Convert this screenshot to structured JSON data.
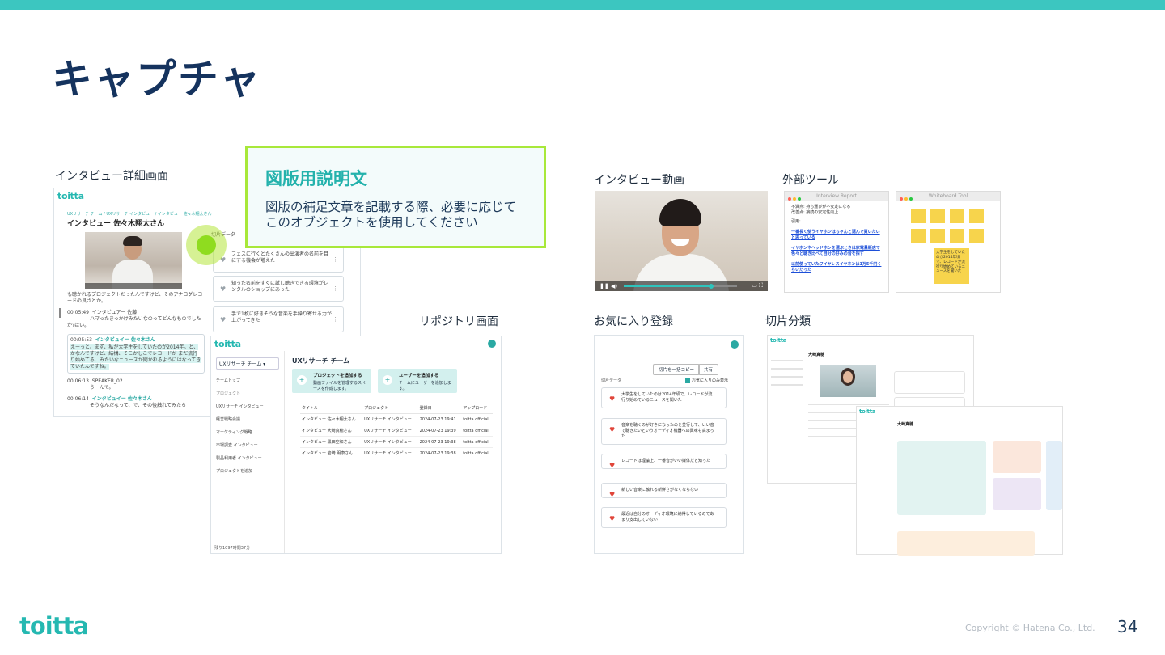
{
  "slide": {
    "title": "キャプチャ",
    "page_number": "34",
    "copyright": "Copyright © Hatena Co., Ltd.",
    "logo": "toitta",
    "accent_color": "#3cc6c0"
  },
  "callout": {
    "title": "図版用説明文",
    "body_line1": "図版の補足文章を記載する際、必要に応じて",
    "body_line2": "このオブジェクトを使用してください"
  },
  "captions": {
    "detail": "インタビュー詳細画面",
    "repository": "リポジトリ画面",
    "video": "インタビュー動画",
    "external": "外部ツール",
    "favorites": "お気に入り登録",
    "classification": "切片分類"
  },
  "detail_screen": {
    "logo": "toitta",
    "breadcrumb": "UXリサーチ チーム / UXリサーチ インタビュー / インタビュー 佐々木翔太さん",
    "title": "インタビュー 佐々木翔太さん",
    "clip_label": "切片データ",
    "transcript": [
      {
        "time": "",
        "speaker": "",
        "text": "も聴かれるプロジェクトだったんですけど、そのアナログレコードの良さとか。"
      },
      {
        "time": "00:05:49",
        "speaker": "インタビュアー 佐藤",
        "text": "ハマったきっかけみたいなのってどんなものでしたか?はい。"
      },
      {
        "time": "00:05:53",
        "speaker": "インタビュイー 佐々木さん",
        "text": "えーっと、まず、私が大学生をしていたのが2014年。と、かなんですけど、結構、そこかしこでレコードが まだ流行り始めてる、みたいなニュースが聞かれるようにはなってきていたんですね。"
      },
      {
        "time": "00:06:13",
        "speaker": "SPEAKER_02",
        "text": "うーんで。"
      },
      {
        "time": "00:06:14",
        "speaker": "インタビュイー 佐々木さん",
        "text": "そうなんだなって、で、その後触れてみたら"
      }
    ],
    "clips": [
      "フェスに行くとたくさんの出演者の名前を目にする機会が増えた",
      "知った名前をすぐに試し聴きできる環境がレンタルのショップにあった",
      "手で1枚に好きそうな音楽を手繰り寄せる力が上がってきた"
    ]
  },
  "repo_screen": {
    "logo": "toitta",
    "team": "UXリサーチ チーム",
    "title": "UXリサーチ チーム",
    "nav_top": "チームトップ",
    "nav_section": "プロジェクト",
    "projects": [
      "UXリサーチ インタビュー",
      "経営戦略会議",
      "マーケティング戦略",
      "市場調査 インタビュー",
      "製品利用者 インタビュー"
    ],
    "add_project_nav": "プロジェクトを追加",
    "action1_title": "プロジェクトを追加する",
    "action1_desc": "動画ファイルを管理するスペースを作成します。",
    "action2_title": "ユーザーを追加する",
    "action2_desc": "チームにユーザーを追加します。",
    "columns": [
      "タイトル",
      "プロジェクト",
      "登録日",
      "アップロード"
    ],
    "rows": [
      [
        "インタビュー 佐々木翔太さん",
        "UXリサーチ インタビュー",
        "2024-07-23 19:41",
        "toitta official"
      ],
      [
        "インタビュー 大崎真穂さん",
        "UXリサーチ インタビュー",
        "2024-07-23 19:39",
        "toitta official"
      ],
      [
        "インタビュー 黒田空和さん",
        "UXリサーチ インタビュー",
        "2024-07-23 19:38",
        "toitta official"
      ],
      [
        "インタビュー 岩崎 明康さん",
        "UXリサーチ インタビュー",
        "2024-07-23 19:38",
        "toitta official"
      ]
    ],
    "footer": "残り1097時間37分"
  },
  "external_tools": {
    "report_title": "Interview Report",
    "report_line1": "不満点: 持ち運びが不安定になる",
    "report_line2": "改善点: 接続の安定性向上",
    "report_line3": "引用:",
    "report_links": [
      "一番長く使うイヤホンはちゃんと選んで買いたいと思っている",
      "イヤホンやヘッドホンを選ぶときは家電量販店で色々と聴き比べて自分の好みの音を探す",
      "以前使っていたワイヤレスイヤホンは1万5千円くらいだった"
    ],
    "whiteboard_title": "Whiteboard Tool",
    "whiteboard_note": "大学生をしていたのが2014年頃で、レコードが流行り始めているニュースを聞いた"
  },
  "favorites_screen": {
    "copy_button": "切片を一括コピー",
    "share_button": "共有",
    "clip_label": "切片データ",
    "fav_only": "お気に入りのみ表示",
    "clips": [
      "大学生をしていたのは2014年頃で、レコードが流行り始めているニュースを聞いた",
      "音楽を聴くのが好きになったのと並行して、いい音で聴きたいというオーディオ機器への興味も高まった",
      "レコードは理論上、一番音がいい媒体だと知った",
      "新しい音楽に触れる新鮮さがなくならない",
      "最近は自分のオーディオ環境に納得しているのであまり支出していない"
    ]
  },
  "classification_screen": {
    "logo": "toitta",
    "title": "大崎真穂"
  }
}
